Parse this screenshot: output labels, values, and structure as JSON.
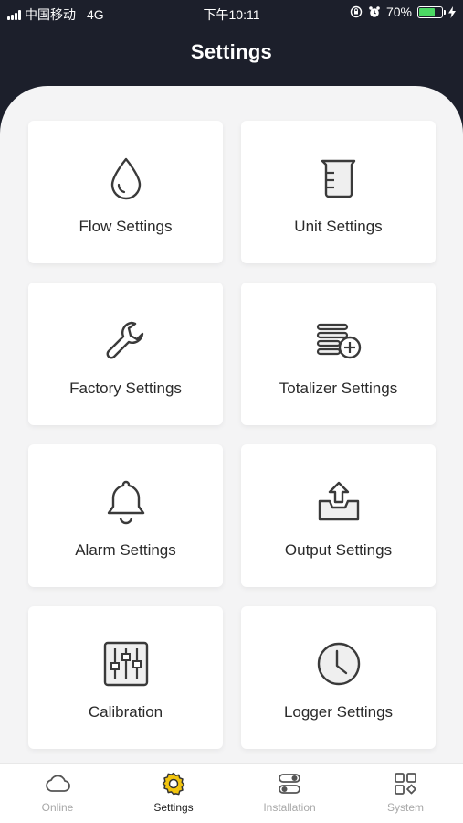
{
  "status_bar": {
    "carrier": "中国移动",
    "network": "4G",
    "time": "下午10:11",
    "battery_percent": "70%",
    "battery_level": 0.7
  },
  "header": {
    "title": "Settings"
  },
  "cards": [
    {
      "label": "Flow Settings",
      "icon": "water-drop-icon"
    },
    {
      "label": "Unit Settings",
      "icon": "measuring-cup-icon"
    },
    {
      "label": "Factory Settings",
      "icon": "wrench-icon"
    },
    {
      "label": "Totalizer Settings",
      "icon": "stack-plus-icon"
    },
    {
      "label": "Alarm Settings",
      "icon": "bell-icon"
    },
    {
      "label": "Output Settings",
      "icon": "upload-tray-icon"
    },
    {
      "label": "Calibration",
      "icon": "sliders-icon"
    },
    {
      "label": "Logger Settings",
      "icon": "clock-icon"
    }
  ],
  "tabbar": {
    "tabs": [
      {
        "label": "Online",
        "icon": "cloud-icon",
        "active": false
      },
      {
        "label": "Settings",
        "icon": "gear-icon",
        "active": true
      },
      {
        "label": "Installation",
        "icon": "toggles-icon",
        "active": false
      },
      {
        "label": "System",
        "icon": "grid-icon",
        "active": false
      }
    ]
  },
  "colors": {
    "header_bg": "#1c1f2b",
    "panel_bg": "#f4f4f5",
    "active_tab_icon": "#f1c40f",
    "battery_fill": "#4cd964"
  }
}
